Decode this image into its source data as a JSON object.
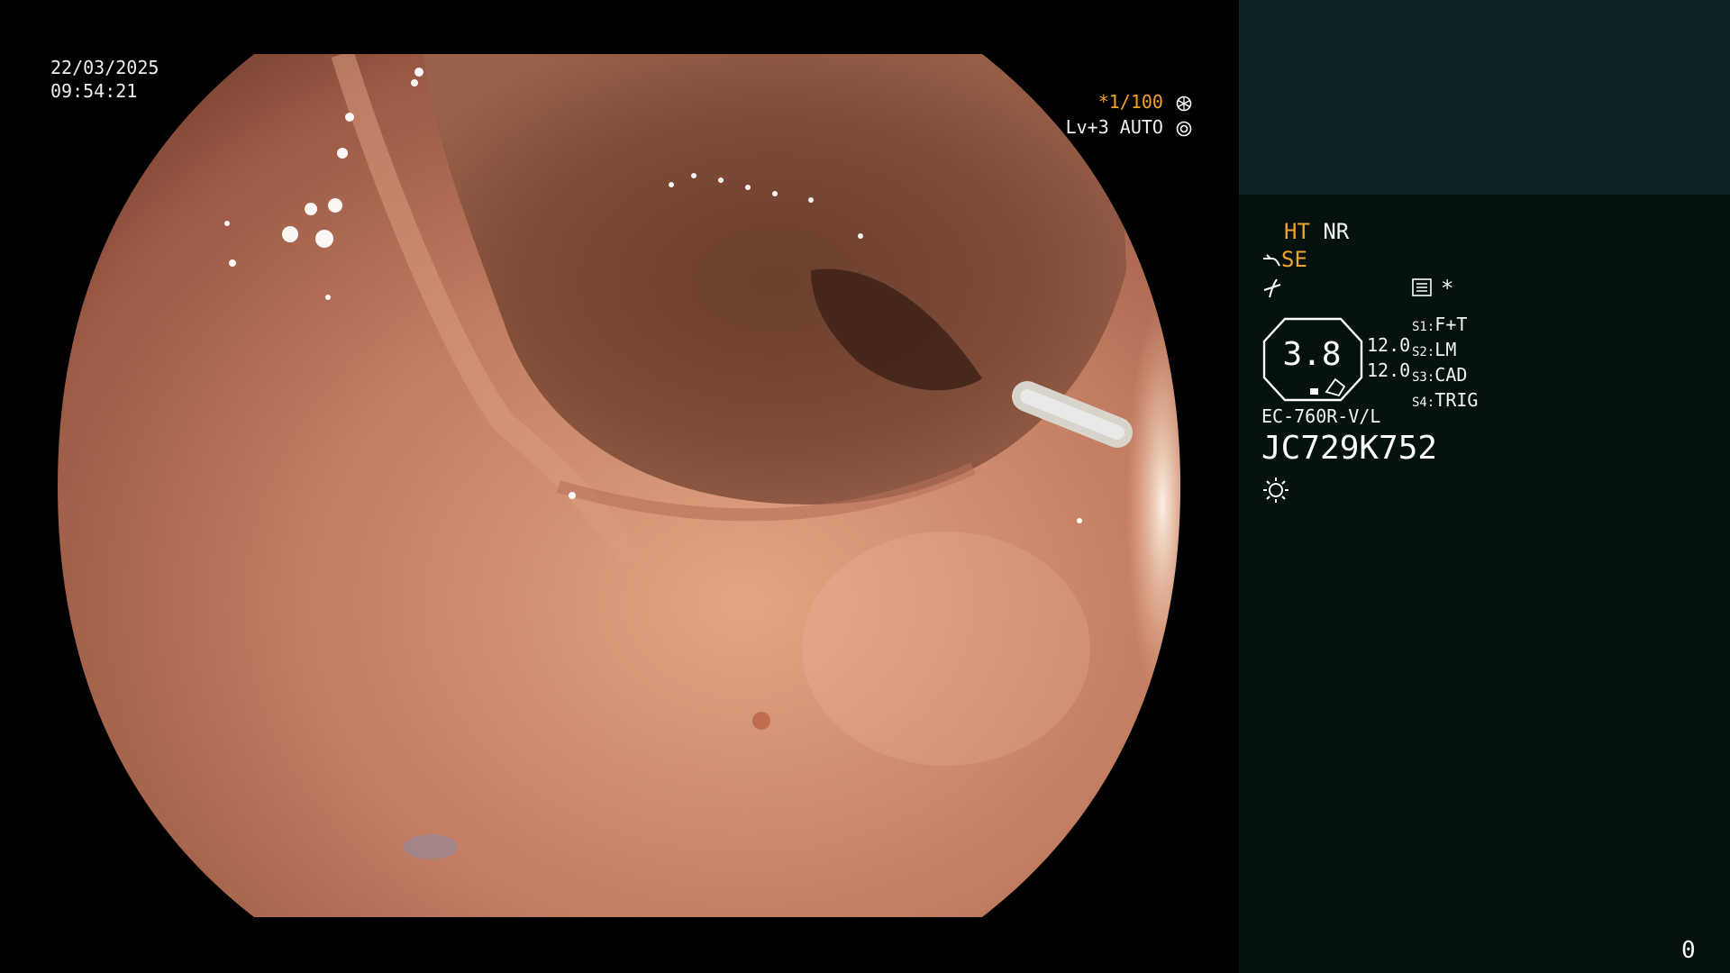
{
  "overlay": {
    "date": "22/03/2025",
    "time": "09:54:21",
    "shutter": "1/100",
    "shutter_marker": "*",
    "light_mode": "Lv+3 AUTO"
  },
  "panel": {
    "mode_ht": "HT",
    "mode_nr": "NR",
    "mode_se": "SE",
    "asterisk": "*",
    "gauge_value": "3.8",
    "value_1": "12.0",
    "value_2": "12.0",
    "switches": [
      {
        "key": "S1",
        "value": "F+T"
      },
      {
        "key": "S2",
        "value": "LM"
      },
      {
        "key": "S3",
        "value": "CAD"
      },
      {
        "key": "S4",
        "value": "TRIG"
      }
    ],
    "scope_model": "EC-760R-V/L",
    "serial": "JC729K752",
    "frame_counter": "0"
  },
  "colors": {
    "accent_orange": "#f0a22a",
    "panel_top": "#0e2424",
    "panel_bg": "#051210"
  },
  "icons": [
    "shutter-icon",
    "iris-icon",
    "scope-bend-icon",
    "flex-icon",
    "menu-card-icon",
    "brightness-icon"
  ]
}
